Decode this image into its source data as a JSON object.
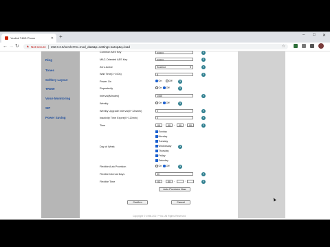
{
  "browser": {
    "tab_title": "Yealink T46D Phone",
    "new_tab": "+",
    "window_controls": [
      "–",
      "□",
      "✕"
    ],
    "security_label": "Not secure",
    "url": "192.0.2.5/servlet?m=mod_data&p=settings-autop&q=load",
    "back": "←",
    "forward": "→",
    "reload": "↻",
    "bookmark": "☆"
  },
  "sidebar": {
    "items": [
      {
        "label": "Ring"
      },
      {
        "label": "Tones"
      },
      {
        "label": "Softkey Layout"
      },
      {
        "label": "TR069"
      },
      {
        "label": "Voice Monitoring"
      },
      {
        "label": "SIP"
      },
      {
        "label": "Power Saving"
      }
    ]
  },
  "form": {
    "rows": {
      "common_aes_key": {
        "label": "Common AES Key",
        "value": "••••••••"
      },
      "mac_aes_key": {
        "label": "MAC-Oriented AES Key",
        "value": "••••••••"
      },
      "zero_active": {
        "label": "Zero Active",
        "value": "Enabled"
      },
      "wait_time": {
        "label": "Wait Time(1~100s)",
        "value": "5"
      },
      "power_on": {
        "label": "Power On",
        "on": "On",
        "off": "Off"
      },
      "repeatedly": {
        "label": "Repeatedly",
        "on": "On",
        "off": "Off"
      },
      "interval": {
        "label": "Interval(Minutes)",
        "value": "1440"
      },
      "weekly": {
        "label": "Weekly",
        "on": "On",
        "off": "Off"
      },
      "weekly_upgrade_interval": {
        "label": "Weekly Upgrade Interval(0~12week)",
        "value": "0"
      },
      "inactivity_time_expire": {
        "label": "Inactivity Time Expire(0~120min)",
        "value": "0"
      },
      "time": {
        "label": "Time",
        "h1": "00",
        "m1": "00",
        "h2": "00",
        "m2": "00",
        "sep": ":",
        "dash": "-"
      },
      "day_of_week": {
        "label": "Day of Week",
        "days": [
          "Sunday",
          "Monday",
          "Tuesday",
          "Wednesday",
          "Thursday",
          "Friday",
          "Saturday"
        ]
      },
      "flexible_auto_provision": {
        "label": "Flexible Auto Provision",
        "on": "On",
        "off": "Off"
      },
      "flexible_interval_days": {
        "label": "Flexible Interval Days",
        "value": "30"
      },
      "flexible_time": {
        "label": "Flexible Time",
        "h1": "02",
        "m1": "00",
        "h2": "",
        "m2": "",
        "sep": ":",
        "dash": "-"
      }
    },
    "auto_provision_now": "Auto Provision Now",
    "confirm": "Confirm",
    "cancel": "Cancel",
    "help_glyph": "?",
    "footer": "Copyright © 1998-2017 **Inc. All Rights Reserved"
  },
  "colors": {
    "link_blue": "#1f4e9c",
    "help_teal": "#2f7f8f",
    "sidebar_gray": "#b6b6b6",
    "radio_blue": "#1a5fcf"
  }
}
